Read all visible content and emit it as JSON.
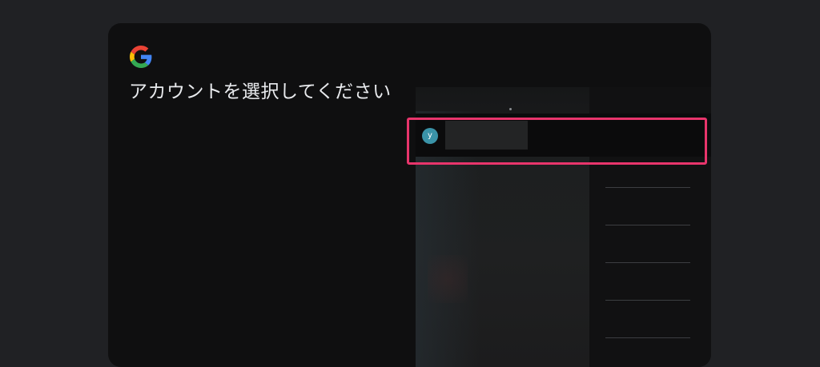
{
  "dialog": {
    "heading": "アカウントを選択してください"
  },
  "account": {
    "avatar_initial": "y"
  },
  "colors": {
    "page_background": "#202124",
    "card_background": "#0f0f10",
    "highlight_border": "#e8356c",
    "avatar_background": "#3a93a8"
  },
  "icons": {
    "brand": "google-g-icon"
  }
}
